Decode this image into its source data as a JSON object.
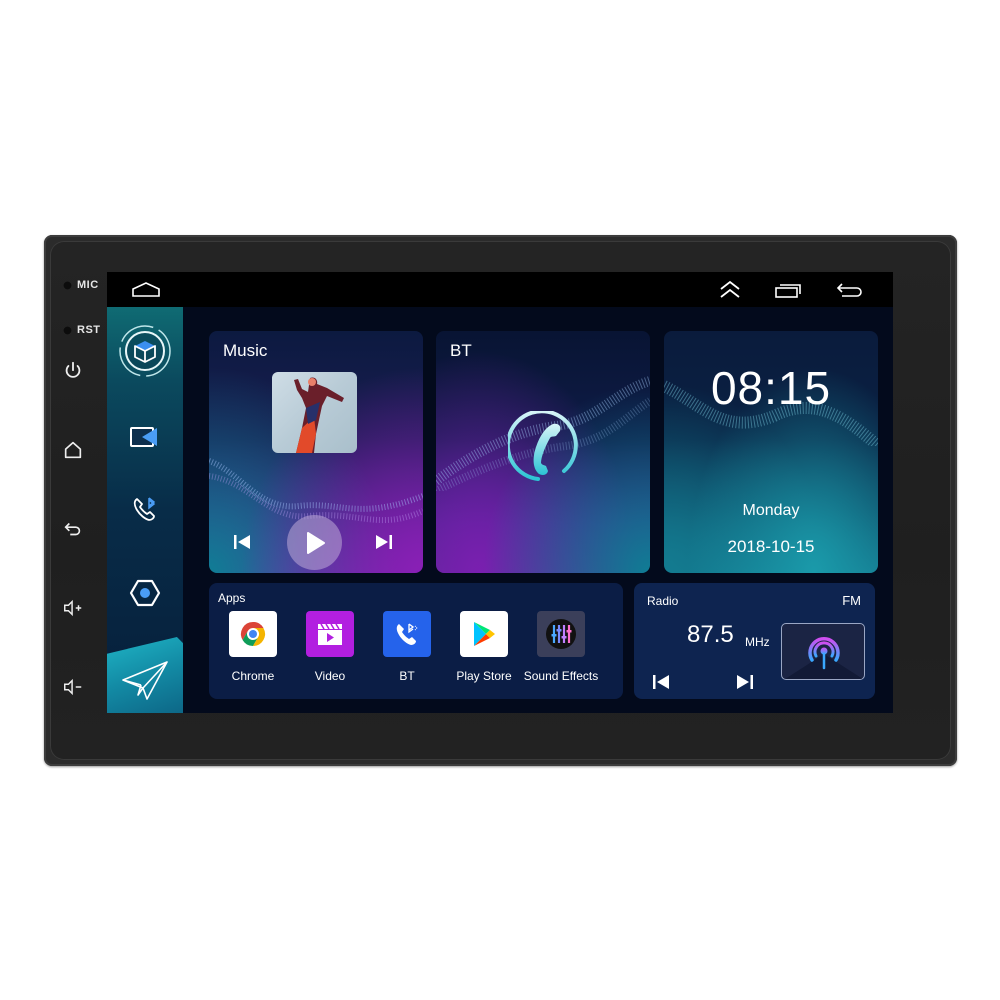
{
  "device": {
    "hw_labels": {
      "mic": "MIC",
      "rst": "RST"
    },
    "hw_buttons": [
      "power-icon",
      "home-icon",
      "back-icon",
      "volume-up-icon",
      "volume-down-icon"
    ]
  },
  "statusbar": {
    "left_icon": "home-outline-icon",
    "right_icons": [
      "double-chevron-up-icon",
      "recent-apps-icon",
      "back-arrow-icon"
    ]
  },
  "dock": {
    "items": [
      "cube-app-icon",
      "video-camera-icon",
      "bluetooth-phone-icon",
      "hexagon-settings-icon",
      "paper-plane-navigation-icon"
    ]
  },
  "music": {
    "title": "Music",
    "controls": [
      "previous-icon",
      "play-icon",
      "next-icon"
    ]
  },
  "bt": {
    "title": "BT",
    "icon": "phone-handset-icon"
  },
  "clock": {
    "time": "08:15",
    "day": "Monday",
    "date": "2018-10-15"
  },
  "apps": {
    "title": "Apps",
    "items": [
      {
        "label": "Chrome",
        "icon": "chrome-icon",
        "bg": "#ffffff"
      },
      {
        "label": "Video",
        "icon": "video-clapper-icon",
        "bg": "#b21fe0"
      },
      {
        "label": "BT",
        "icon": "bt-phone-icon",
        "bg": "#2563eb"
      },
      {
        "label": "Play Store",
        "icon": "play-store-icon",
        "bg": "#ffffff"
      },
      {
        "label": "Sound Effects",
        "icon": "equalizer-icon",
        "bg": "#3b3f5a"
      }
    ]
  },
  "radio": {
    "title": "Radio",
    "band": "FM",
    "frequency": "87.5",
    "unit": "MHz",
    "controls": [
      "previous-icon",
      "next-icon"
    ],
    "art_icon": "broadcast-antenna-icon"
  },
  "colors": {
    "accent_cyan": "#2fc6d6",
    "accent_purple": "#8a1fb6",
    "bezel": "#2b2b2b"
  }
}
